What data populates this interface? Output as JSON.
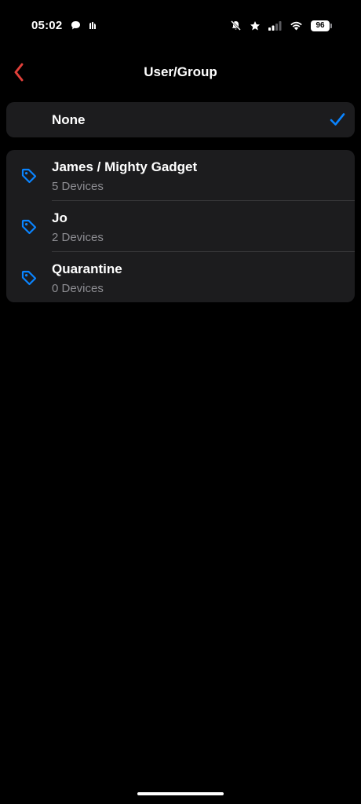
{
  "status_bar": {
    "time": "05:02",
    "battery": "96"
  },
  "nav": {
    "title": "User/Group"
  },
  "none_option": {
    "label": "None",
    "selected": true
  },
  "groups": [
    {
      "name": "James / Mighty Gadget",
      "devices": "5 Devices"
    },
    {
      "name": "Jo",
      "devices": "2 Devices"
    },
    {
      "name": "Quarantine",
      "devices": "0 Devices"
    }
  ],
  "colors": {
    "background": "#000000",
    "card": "#1c1c1e",
    "accent_blue": "#0a84ff",
    "back_red": "#e0403a",
    "secondary_text": "#8e8e93"
  },
  "icons": {
    "back": "chevron-left-icon",
    "check": "checkmark-icon",
    "group": "tag-icon"
  }
}
